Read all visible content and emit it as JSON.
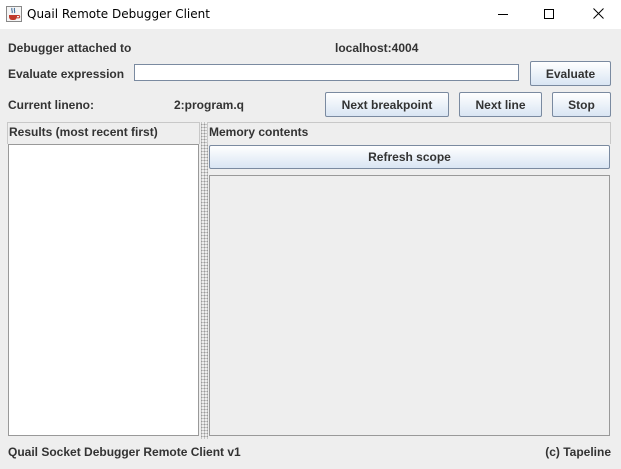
{
  "window": {
    "title": "Quail Remote Debugger Client",
    "icon": "java-cup-icon"
  },
  "controls": {
    "minimize_icon": "minimize-icon",
    "maximize_icon": "maximize-icon",
    "close_icon": "close-icon"
  },
  "connection": {
    "label": "Debugger attached to",
    "host": "localhost:4004"
  },
  "evaluate": {
    "label": "Evaluate expression",
    "value": "",
    "placeholder": "",
    "button_label": "Evaluate"
  },
  "position": {
    "label": "Current lineno:",
    "value": "2:program.q"
  },
  "actions": {
    "next_breakpoint": "Next breakpoint",
    "next_line": "Next line",
    "stop": "Stop"
  },
  "results": {
    "header": "Results (most recent first)",
    "items": []
  },
  "memory": {
    "header": "Memory contents",
    "refresh_label": "Refresh scope"
  },
  "footer": {
    "left": "Quail Socket Debugger Remote Client v1",
    "right": "(c) Tapeline"
  },
  "colors": {
    "window_bg": "#eeeeee",
    "titlebar_bg": "#ffffff",
    "button_gradient_top": "#ffffff",
    "button_gradient_bottom": "#d9e5f3",
    "button_border": "#7a8aa0",
    "label_text": "#333333"
  }
}
